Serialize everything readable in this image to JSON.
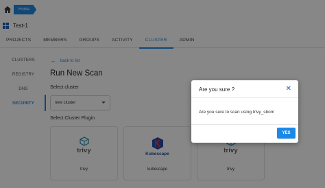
{
  "header": {
    "breadcrumb": "Home",
    "project_title": "Test-1"
  },
  "tabs": [
    {
      "label": "PROJECTS"
    },
    {
      "label": "MEMBERS"
    },
    {
      "label": "GROUPS"
    },
    {
      "label": "ACTIVITY"
    },
    {
      "label": "CLUSTER",
      "active": true
    },
    {
      "label": "ADMIN"
    }
  ],
  "sidebar": {
    "items": [
      {
        "label": "CLUSTERS"
      },
      {
        "label": "REGISTRY"
      },
      {
        "label": "DNS"
      },
      {
        "label": "SECURITY",
        "active": true
      }
    ]
  },
  "main": {
    "back_label": "back to list",
    "title": "Run New Scan",
    "select_cluster_label": "Select cluster",
    "select_value": "new cluster",
    "select_plugin_label": "Select Cluster Plugin",
    "plugins": [
      {
        "name": "trivy",
        "logo_text": "trivy",
        "icon": "trivy-logo-icon"
      },
      {
        "name": "kubescape",
        "logo_text": "Kubescape",
        "icon": "kubescape-logo-icon"
      },
      {
        "name": "trivy",
        "logo_text": "trivy",
        "icon": "trivy-logo-icon"
      }
    ]
  },
  "dialog": {
    "title": "Are you sure ?",
    "body": "Are you sure to scan using trivy_sbom",
    "yes_label": "YES"
  },
  "colors": {
    "accent": "#1e88e5",
    "overlay": "rgba(0,0,0,0.47)"
  }
}
